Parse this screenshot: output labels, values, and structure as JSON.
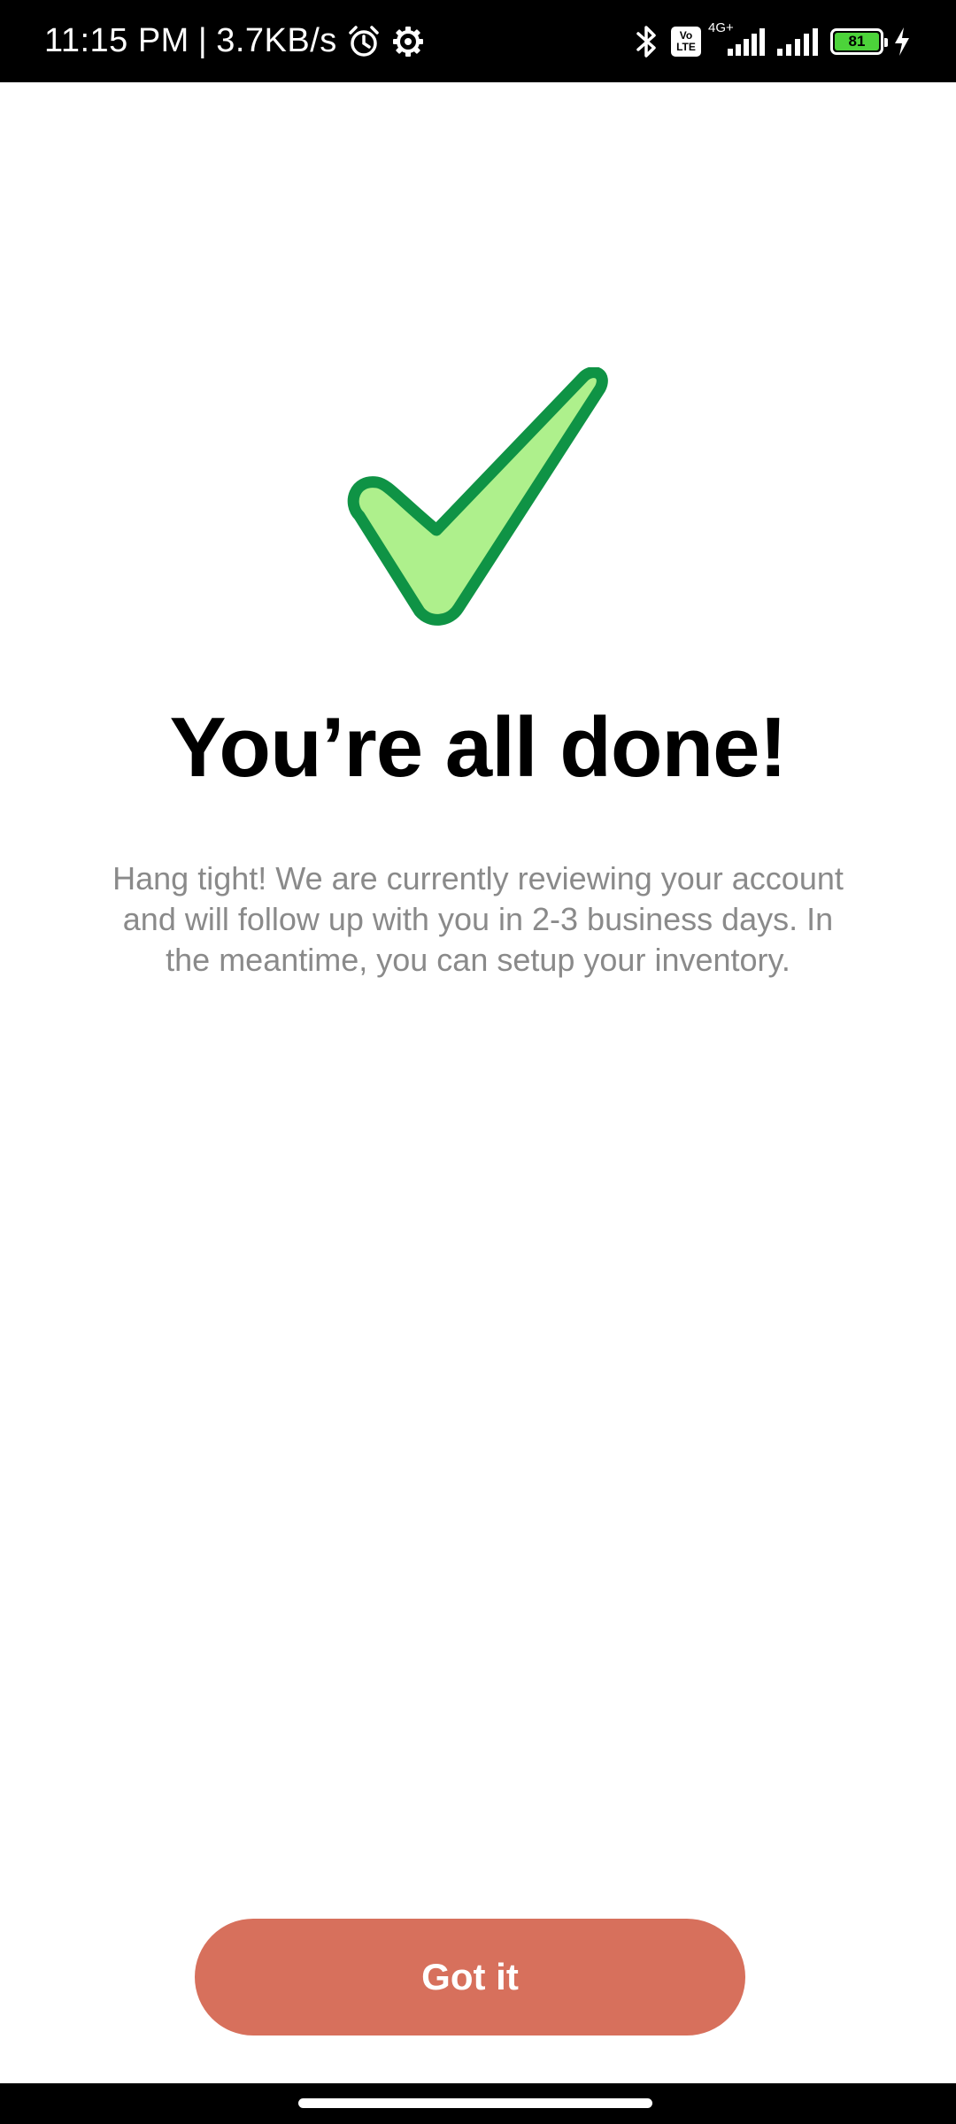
{
  "status_bar": {
    "time": "11:15 PM",
    "separator": "|",
    "network_speed": "3.7KB/s",
    "icons": [
      "alarm-icon",
      "settings-icon",
      "bluetooth-icon",
      "volte-icon",
      "signal-icon",
      "signal-icon",
      "battery-icon",
      "charging-icon"
    ],
    "volte_line1": "Vo",
    "volte_line2": "LTE",
    "network_type": "4G+",
    "battery_level": "81",
    "battery_color": "#4cd33a"
  },
  "main": {
    "icon": "checkmark-icon",
    "check_fill": "#aef08c",
    "check_stroke": "#0f9345",
    "title": "You’re all done!",
    "description": "Hang tight!  We are currently reviewing your account\nand will follow up with you in 2-3 business days. In\nthe meantime, you can setup your inventory."
  },
  "actions": {
    "primary_label": "Got it",
    "primary_color": "#d7705c"
  }
}
